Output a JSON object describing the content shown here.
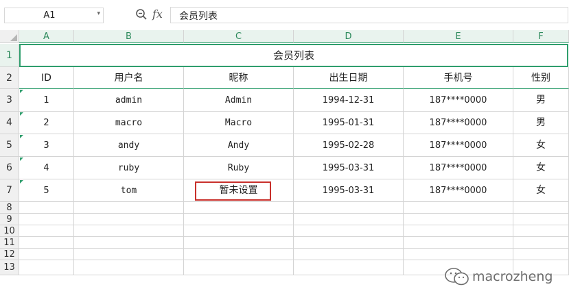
{
  "formula_bar": {
    "name_box": "A1",
    "fx_label": "fx",
    "value": "会员列表"
  },
  "column_headers": [
    "A",
    "B",
    "C",
    "D",
    "E",
    "F"
  ],
  "row_headers": [
    "1",
    "2",
    "3",
    "4",
    "5",
    "6",
    "7",
    "8",
    "9",
    "10",
    "11",
    "12",
    "13"
  ],
  "title": "会员列表",
  "table": {
    "headers": [
      "ID",
      "用户名",
      "昵称",
      "出生日期",
      "手机号",
      "性别"
    ],
    "rows": [
      [
        "1",
        "admin",
        "Admin",
        "1994-12-31",
        "187****0000",
        "男"
      ],
      [
        "2",
        "macro",
        "Macro",
        "1995-01-31",
        "187****0000",
        "男"
      ],
      [
        "3",
        "andy",
        "Andy",
        "1995-02-28",
        "187****0000",
        "女"
      ],
      [
        "4",
        "ruby",
        "Ruby",
        "1995-03-31",
        "187****0000",
        "女"
      ],
      [
        "5",
        "tom",
        "暂未设置",
        "1995-03-31",
        "187****0000",
        "女"
      ]
    ]
  },
  "watermark": {
    "text": "macrozheng",
    "icon": "wechat-icon"
  },
  "colors": {
    "accent": "#2f9e6d",
    "highlight": "#c8302b"
  }
}
